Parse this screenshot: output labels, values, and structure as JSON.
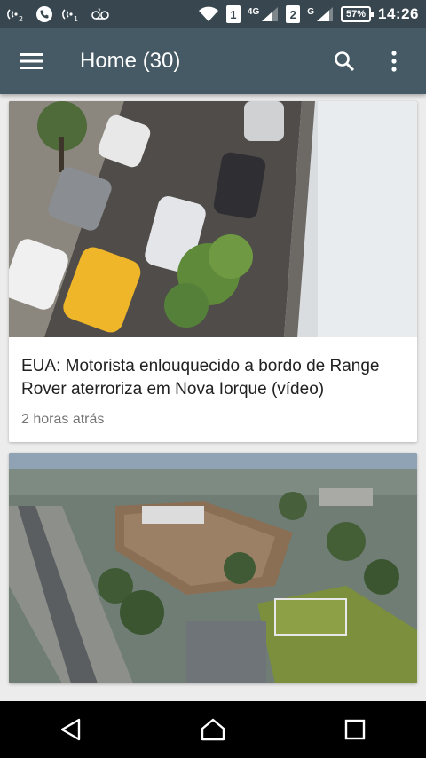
{
  "status_bar": {
    "sim1": "1",
    "sim1_network": "4G",
    "sim2": "2",
    "sim2_network": "G",
    "battery": "57%",
    "time": "14:26"
  },
  "app_bar": {
    "title": "Home (30)"
  },
  "feed": {
    "articles": [
      {
        "title": "EUA: Motorista enlouquecido a bordo de Range Rover aterroriza em Nova Iorque (vídeo)",
        "time": "2 horas atrás"
      }
    ]
  },
  "colors": {
    "status_bar": "#38474f",
    "app_bar": "#455a64",
    "background": "#ececec"
  }
}
